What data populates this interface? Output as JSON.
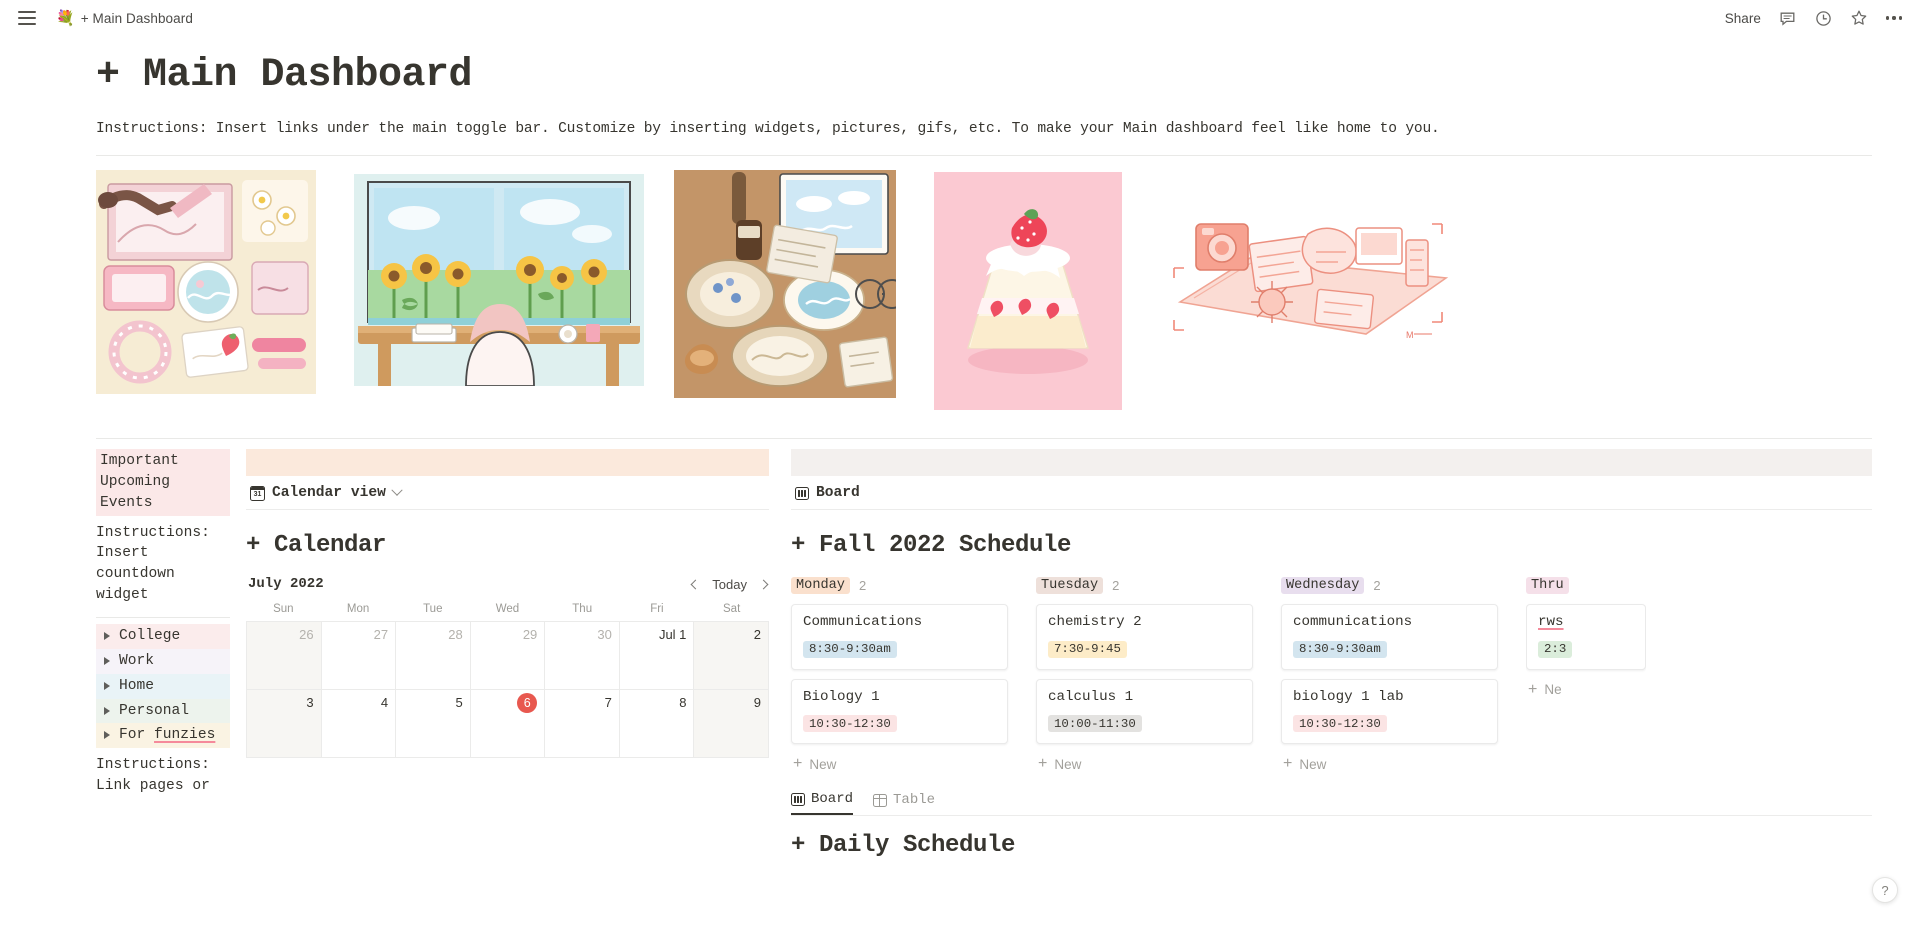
{
  "topbar": {
    "emoji": "💐",
    "breadcrumb": "+ Main Dashboard",
    "share_label": "Share",
    "icons": [
      "menu-icon",
      "comment-icon",
      "history-clock-icon",
      "star-icon",
      "more-options-icon"
    ]
  },
  "page": {
    "title": "+ Main Dashboard",
    "instructions": "Instructions: Insert links under the main toggle bar. Customize by inserting widgets, pictures, gifs, etc. To make your Main dashboard feel like home to you."
  },
  "gallery": [
    {
      "name": "desk-flatlay-strawberry-illustration"
    },
    {
      "name": "girl-at-window-sunflowers-illustration"
    },
    {
      "name": "coffee-breakfast-flatlay-illustration"
    },
    {
      "name": "strawberry-shortcake-pink-illustration"
    },
    {
      "name": "polaroid-picnic-flatlay-illustration"
    }
  ],
  "sidebar": {
    "heading": "Important Upcoming Events",
    "instructions": "Instructions: Insert countdown widget",
    "toggles": [
      {
        "label": "College",
        "color": "#fbecec"
      },
      {
        "label": "Work",
        "color": "#f6f3f9"
      },
      {
        "label": "Home",
        "color": "#e9f3f7"
      },
      {
        "label": "Personal",
        "color": "#edf3ed"
      },
      {
        "label": "For funzies",
        "color": "#faf3e3",
        "underlined_word": "funzies"
      }
    ],
    "footer_instructions": "Instructions: Link pages or"
  },
  "calendar": {
    "view_label": "Calendar view",
    "view_icon": "calendar-31-icon",
    "block_title": "+ Calendar",
    "month": "July 2022",
    "today_label": "Today",
    "prev_icon": "chevron-left-icon",
    "next_icon": "chevron-right-icon",
    "weekdays": [
      "Sun",
      "Mon",
      "Tue",
      "Wed",
      "Thu",
      "Fri",
      "Sat"
    ],
    "weeks": [
      [
        {
          "label": "26",
          "dim": true,
          "weekend": true
        },
        {
          "label": "27",
          "dim": true,
          "weekend": false
        },
        {
          "label": "28",
          "dim": true,
          "weekend": false
        },
        {
          "label": "29",
          "dim": true,
          "weekend": false
        },
        {
          "label": "30",
          "dim": true,
          "weekend": false
        },
        {
          "label": "Jul 1",
          "dim": false,
          "weekend": false
        },
        {
          "label": "2",
          "dim": false,
          "weekend": true
        }
      ],
      [
        {
          "label": "3",
          "dim": false,
          "weekend": true
        },
        {
          "label": "4",
          "dim": false,
          "weekend": false
        },
        {
          "label": "5",
          "dim": false,
          "weekend": false
        },
        {
          "label": "6",
          "dim": false,
          "weekend": false,
          "today": true
        },
        {
          "label": "7",
          "dim": false,
          "weekend": false
        },
        {
          "label": "8",
          "dim": false,
          "weekend": false
        },
        {
          "label": "9",
          "dim": false,
          "weekend": true
        }
      ]
    ],
    "today_color": "#e8584f"
  },
  "board": {
    "view_label": "Board",
    "view_icon": "board-icon",
    "block_title": "+ Fall 2022 Schedule",
    "columns": [
      {
        "name": "Monday",
        "tag_color": "#fae0cd",
        "count": "2",
        "cards": [
          {
            "title": "Communications",
            "time": "8:30-9:30am",
            "badge_color": "#d3e5ef"
          },
          {
            "title": "Biology 1",
            "time": "10:30-12:30",
            "badge_color": "#fbe4e4"
          }
        ],
        "new_label": "New"
      },
      {
        "name": "Tuesday",
        "tag_color": "#eee0da",
        "count": "2",
        "cards": [
          {
            "title": "chemistry 2",
            "time": "7:30-9:45",
            "badge_color": "#fdecc8"
          },
          {
            "title": "calculus 1",
            "time": "10:00-11:30",
            "badge_color": "#e3e2e0"
          }
        ],
        "new_label": "New"
      },
      {
        "name": "Wednesday",
        "tag_color": "#e8deee",
        "count": "2",
        "cards": [
          {
            "title": "communications",
            "time": "8:30-9:30am",
            "badge_color": "#d3e5ef"
          },
          {
            "title": "biology 1 lab",
            "time": "10:30-12:30",
            "badge_color": "#fbe4e4"
          }
        ],
        "new_label": "New"
      },
      {
        "name": "Thru",
        "tag_color": "#f5e0e9",
        "count": "",
        "clipped": true,
        "cards": [
          {
            "title": "rws",
            "time": "2:3",
            "badge_color": "#dbeddb",
            "underlined": true
          }
        ],
        "new_label": "Ne"
      }
    ],
    "tabs": [
      {
        "label": "Board",
        "icon": "board-icon",
        "active": true
      },
      {
        "label": "Table",
        "icon": "table-icon",
        "active": false
      }
    ],
    "daily_title": "+ Daily Schedule"
  },
  "help": {
    "label": "?"
  }
}
